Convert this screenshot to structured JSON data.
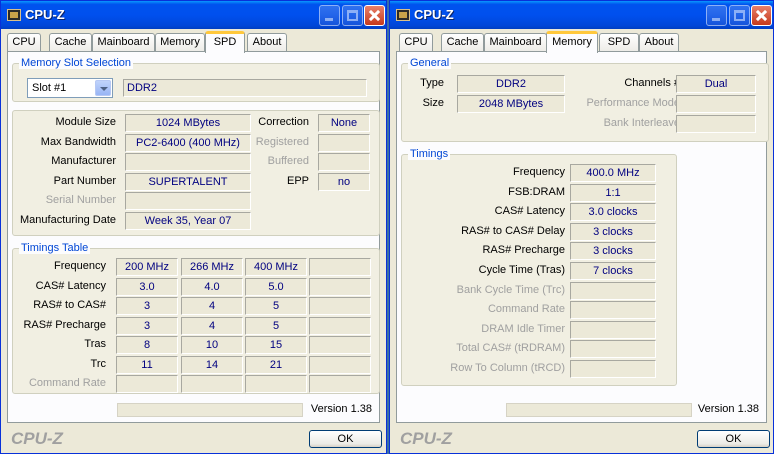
{
  "left": {
    "title": "CPU-Z",
    "tabs": [
      "CPU",
      "Cache",
      "Mainboard",
      "Memory",
      "SPD",
      "About"
    ],
    "active_tab": "SPD",
    "slot_group_title": "Memory Slot Selection",
    "slot_selected": "Slot #1",
    "slot_type": "DDR2",
    "module_size_label": "Module Size",
    "module_size": "1024 MBytes",
    "max_bw_label": "Max Bandwidth",
    "max_bw": "PC2-6400 (400 MHz)",
    "manufacturer_label": "Manufacturer",
    "manufacturer": "",
    "part_number_label": "Part Number",
    "part_number": "SUPERTALENT",
    "serial_label": "Serial Number",
    "serial": "",
    "mfg_date_label": "Manufacturing Date",
    "mfg_date": "Week 35, Year 07",
    "correction_label": "Correction",
    "correction": "None",
    "registered_label": "Registered",
    "registered": "",
    "buffered_label": "Buffered",
    "buffered": "",
    "epp_label": "EPP",
    "epp": "no",
    "timings_title": "Timings Table",
    "timings_rows": [
      {
        "label": "Frequency",
        "dim": false,
        "values": [
          "200 MHz",
          "266 MHz",
          "400 MHz",
          ""
        ]
      },
      {
        "label": "CAS# Latency",
        "dim": false,
        "values": [
          "3.0",
          "4.0",
          "5.0",
          ""
        ]
      },
      {
        "label": "RAS# to CAS#",
        "dim": false,
        "values": [
          "3",
          "4",
          "5",
          ""
        ]
      },
      {
        "label": "RAS# Precharge",
        "dim": false,
        "values": [
          "3",
          "4",
          "5",
          ""
        ]
      },
      {
        "label": "Tras",
        "dim": false,
        "values": [
          "8",
          "10",
          "15",
          ""
        ]
      },
      {
        "label": "Trc",
        "dim": false,
        "values": [
          "11",
          "14",
          "21",
          ""
        ]
      },
      {
        "label": "Command Rate",
        "dim": true,
        "values": [
          "",
          "",
          "",
          ""
        ]
      }
    ],
    "version": "Version 1.38",
    "brand": "CPU-Z",
    "ok": "OK"
  },
  "right": {
    "title": "CPU-Z",
    "tabs": [
      "CPU",
      "Cache",
      "Mainboard",
      "Memory",
      "SPD",
      "About"
    ],
    "active_tab": "Memory",
    "general_title": "General",
    "type_label": "Type",
    "type": "DDR2",
    "size_label": "Size",
    "size": "2048 MBytes",
    "channels_label": "Channels #",
    "channels": "Dual",
    "perf_mode_label": "Performance Mode",
    "perf_mode": "",
    "bank_interleave_label": "Bank Interleave",
    "bank_interleave": "",
    "timings_title": "Timings",
    "timings": [
      {
        "label": "Frequency",
        "value": "400.0 MHz",
        "dim": false
      },
      {
        "label": "FSB:DRAM",
        "value": "1:1",
        "dim": false
      },
      {
        "label": "CAS# Latency",
        "value": "3.0 clocks",
        "dim": false
      },
      {
        "label": "RAS# to CAS# Delay",
        "value": "3 clocks",
        "dim": false
      },
      {
        "label": "RAS# Precharge",
        "value": "3 clocks",
        "dim": false
      },
      {
        "label": "Cycle Time (Tras)",
        "value": "7 clocks",
        "dim": false
      },
      {
        "label": "Bank Cycle Time (Trc)",
        "value": "",
        "dim": true
      },
      {
        "label": "Command Rate",
        "value": "",
        "dim": true
      },
      {
        "label": "DRAM Idle Timer",
        "value": "",
        "dim": true
      },
      {
        "label": "Total CAS# (tRDRAM)",
        "value": "",
        "dim": true
      },
      {
        "label": "Row To Column (tRCD)",
        "value": "",
        "dim": true
      }
    ],
    "version": "Version 1.38",
    "brand": "CPU-Z",
    "ok": "OK"
  },
  "icons": {
    "app": "cpu-chip-icon",
    "minimize": "minimize-icon",
    "maximize": "maximize-icon",
    "close": "close-icon",
    "dropdown": "chevron-down-icon"
  },
  "colors": {
    "titlebar": "#0053ee",
    "value_text": "#000080",
    "group_title": "#0046d5",
    "active_tab_accent": "#ffc83c",
    "close_button": "#c5391c"
  }
}
